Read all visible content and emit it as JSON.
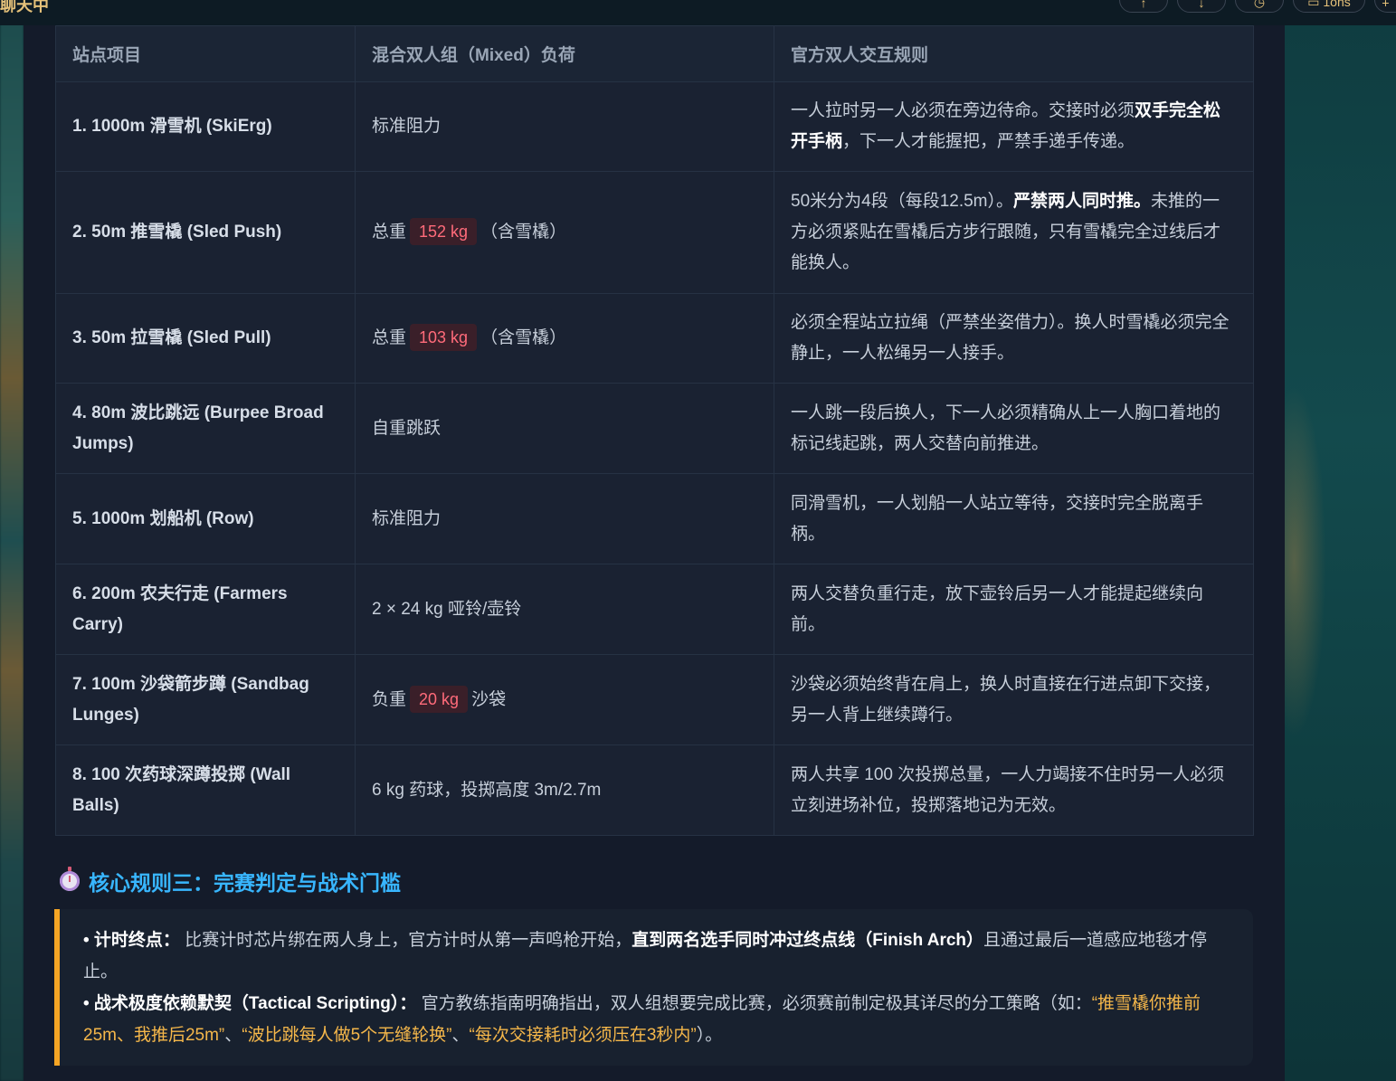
{
  "topbar": {
    "title": "聊天中",
    "buttons": [
      "↑",
      "↓",
      "◷",
      "▭ 1ons",
      "+"
    ]
  },
  "table": {
    "headers": [
      "站点项目",
      "混合双人组（Mixed）负荷",
      "官方双人交互规则"
    ],
    "rows": [
      {
        "station": "1. 1000m 滑雪机 (SkiErg)",
        "load": {
          "pre": "标准阻力"
        },
        "rule": [
          {
            "t": "一人拉时另一人必须在旁边待命。交接时必须"
          },
          {
            "t": "双手完全松开手柄",
            "b": true
          },
          {
            "t": "，下一人才能握把，严禁手递手传递。"
          }
        ]
      },
      {
        "station": "2. 50m 推雪橇 (Sled Push)",
        "load": {
          "pre": "总重",
          "badge": "152 kg",
          "post": "（含雪橇）"
        },
        "rule": [
          {
            "t": "50米分为4段（每段12.5m）。"
          },
          {
            "t": "严禁两人同时推。",
            "b": true
          },
          {
            "t": "未推的一方必须紧贴在雪橇后方步行跟随，只有雪橇完全过线后才能换人。"
          }
        ]
      },
      {
        "station": "3. 50m 拉雪橇 (Sled Pull)",
        "load": {
          "pre": "总重",
          "badge": "103 kg",
          "post": "（含雪橇）"
        },
        "rule": [
          {
            "t": "必须全程站立拉绳（严禁坐姿借力）。换人时雪橇必须完全静止，一人松绳另一人接手。"
          }
        ]
      },
      {
        "station": "4. 80m 波比跳远 (Burpee Broad Jumps)",
        "load": {
          "pre": "自重跳跃"
        },
        "rule": [
          {
            "t": "一人跳一段后换人，下一人必须精确从上一人胸口着地的标记线起跳，两人交替向前推进。"
          }
        ]
      },
      {
        "station": "5. 1000m 划船机 (Row)",
        "load": {
          "pre": "标准阻力"
        },
        "rule": [
          {
            "t": "同滑雪机，一人划船一人站立等待，交接时完全脱离手柄。"
          }
        ]
      },
      {
        "station": "6. 200m 农夫行走 (Farmers Carry)",
        "load": {
          "pre": "2 × 24 kg 哑铃/壶铃"
        },
        "rule": [
          {
            "t": "两人交替负重行走，放下壶铃后另一人才能提起继续向前。"
          }
        ]
      },
      {
        "station": "7. 100m 沙袋箭步蹲 (Sandbag Lunges)",
        "load": {
          "pre": "负重",
          "badge": "20 kg",
          "post": "沙袋"
        },
        "rule": [
          {
            "t": "沙袋必须始终背在肩上，换人时直接在行进点卸下交接，另一人背上继续蹲行。"
          }
        ]
      },
      {
        "station": "8. 100 次药球深蹲投掷 (Wall Balls)",
        "load": {
          "pre": "6 kg 药球，投掷高度 3m/2.7m"
        },
        "rule": [
          {
            "t": "两人共享 100 次投掷总量，一人力竭接不住时另一人必须立刻进场补位，投掷落地记为无效。"
          }
        ]
      }
    ]
  },
  "section": {
    "icon": "stopwatch-icon",
    "title": "核心规则三：完赛判定与战术门槛"
  },
  "callout": {
    "item1": {
      "label": "• 计时终点：",
      "text1": "比赛计时芯片绑在两人身上，官方计时从第一声鸣枪开始，",
      "strong": "直到两名选手同时冲过终点线（Finish Arch）",
      "text2": "且通过最后一道感应地毯才停止。"
    },
    "item2": {
      "label": "• 战术极度依赖默契（Tactical Scripting）：",
      "text1": "官方教练指南明确指出，双人组想要完成比赛，必须赛前制定极其详尽的分工策略（如：",
      "q1": "“推雪橇你推前25m、我推后25m”",
      "sep1": "、",
      "q2": "“波比跳每人做5个无缝轮换”",
      "sep2": "、",
      "q3": "“每次交接耗时必须压在3秒内”",
      "end": "）。"
    }
  },
  "colors": {
    "accent_blue": "#38b6ff",
    "accent_orange": "#f5a524",
    "badge_red": "#ff6b7a",
    "panel_bg": "#141b2a"
  }
}
